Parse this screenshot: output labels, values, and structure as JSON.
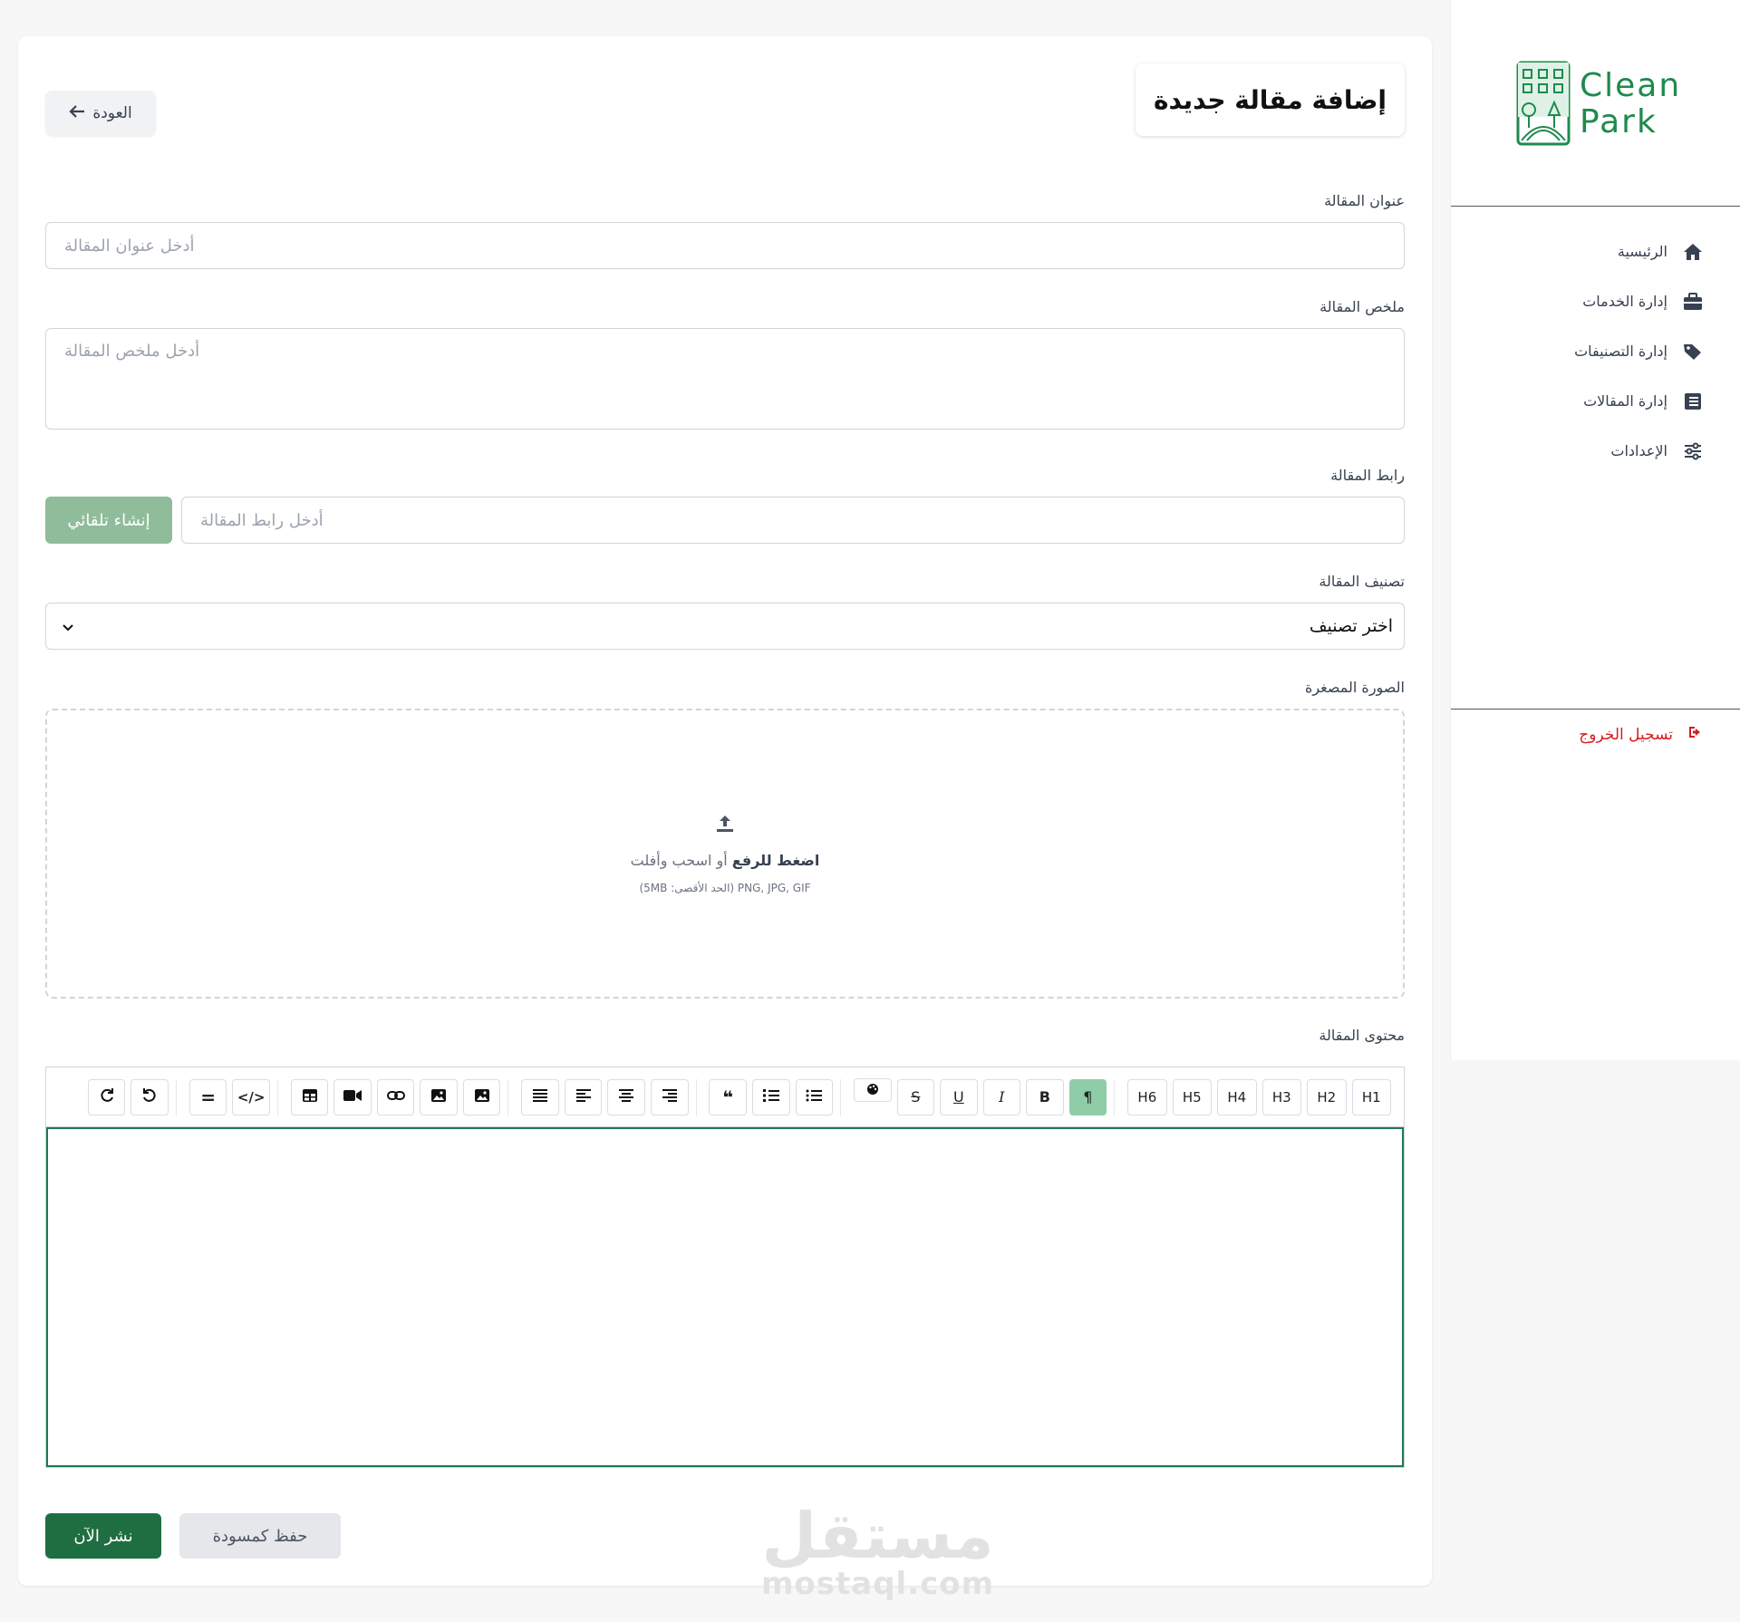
{
  "sidebar": {
    "logo": {
      "line1": "Clean",
      "line2": "Park"
    },
    "items": [
      {
        "label": "الرئيسية",
        "icon": "home-icon"
      },
      {
        "label": "إدارة الخدمات",
        "icon": "briefcase-icon"
      },
      {
        "label": "إدارة التصنيفات",
        "icon": "tag-icon"
      },
      {
        "label": "إدارة المقالات",
        "icon": "book-icon"
      },
      {
        "label": "الإعدادات",
        "icon": "sliders-icon"
      }
    ],
    "logout": "تسجيل الخروج"
  },
  "header": {
    "title": "إضافة مقالة جديدة",
    "back": "العودة"
  },
  "form": {
    "title": {
      "label": "عنوان المقالة",
      "placeholder": "أدخل عنوان المقالة"
    },
    "summary": {
      "label": "ملخص المقالة",
      "placeholder": "أدخل ملخص المقالة"
    },
    "link": {
      "label": "رابط المقالة",
      "placeholder": "أدخل رابط المقالة",
      "auto_button": "إنشاء تلقائي"
    },
    "category": {
      "label": "تصنيف المقالة",
      "selected": "اختر تصنيف"
    },
    "thumbnail": {
      "label": "الصورة المصغرة",
      "click_text": "اضغط للرفع",
      "or_text": "أو اسحب وأفلت",
      "hint": "PNG, JPG, GIF (الحد الأقصى: 5MB)"
    },
    "content": {
      "label": "محتوى المقالة"
    }
  },
  "toolbar": {
    "headings": [
      "H1",
      "H2",
      "H3",
      "H4",
      "H5",
      "H6"
    ]
  },
  "actions": {
    "publish": "نشر الآن",
    "draft": "حفظ كمسودة"
  },
  "watermark": {
    "ar": "مستقل",
    "en": "mostaql.com"
  },
  "colors": {
    "primary": "#1f6e41",
    "auto_button": "#8fbc9a",
    "logout": "#d91c1c",
    "brand": "#1f8a4c"
  }
}
